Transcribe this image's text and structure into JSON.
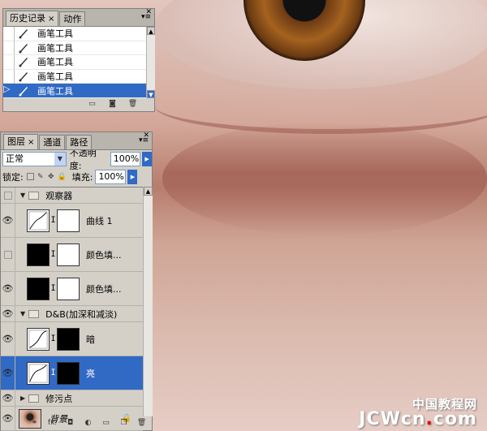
{
  "history_panel": {
    "tabs": [
      {
        "label": "历史记录",
        "active": true,
        "close": "×"
      },
      {
        "label": "动作",
        "active": false
      }
    ],
    "menu_glyph": "▾≡",
    "items": [
      {
        "label": "画笔工具",
        "selected": false
      },
      {
        "label": "画笔工具",
        "selected": false
      },
      {
        "label": "画笔工具",
        "selected": false
      },
      {
        "label": "画笔工具",
        "selected": false
      },
      {
        "label": "画笔工具",
        "selected": true
      }
    ],
    "footer_icons": [
      "new-document-from-state-icon",
      "camera-snapshot-icon",
      "trash-icon"
    ]
  },
  "layers_panel": {
    "tabs": [
      {
        "label": "图层",
        "active": true,
        "close": "×"
      },
      {
        "label": "通道",
        "active": false
      },
      {
        "label": "路径",
        "active": false
      }
    ],
    "blend_mode": "正常",
    "opacity_label": "不透明度:",
    "opacity_value": "100%",
    "lock_label": "锁定:",
    "fill_label": "填充:",
    "fill_value": "100%",
    "layers": {
      "group_observer": {
        "name": "观察器",
        "visible": false
      },
      "curves1": {
        "name": "曲线 1",
        "visible": true
      },
      "color_fill_a": {
        "name": "颜色填...",
        "visible": false
      },
      "color_fill_b": {
        "name": "颜色填...",
        "visible": true
      },
      "group_db": {
        "name": "D&B(加深和减淡)",
        "visible": true
      },
      "dark": {
        "name": "暗",
        "visible": true
      },
      "light": {
        "name": "亮",
        "visible": true,
        "selected": true
      },
      "group_retouch": {
        "name": "修污点",
        "visible": true
      },
      "background": {
        "name": "背景",
        "visible": true,
        "locked": true
      }
    },
    "footer_icons": [
      "link-layers-icon",
      "fx-icon",
      "add-mask-icon",
      "adjustment-layer-icon",
      "new-group-icon",
      "new-layer-icon",
      "trash-icon"
    ],
    "footer_labels": {
      "fx": "fx."
    }
  },
  "watermark": {
    "top": "中国教程网",
    "main_a": "JCWcn",
    "dot": ".",
    "main_b": "com"
  }
}
